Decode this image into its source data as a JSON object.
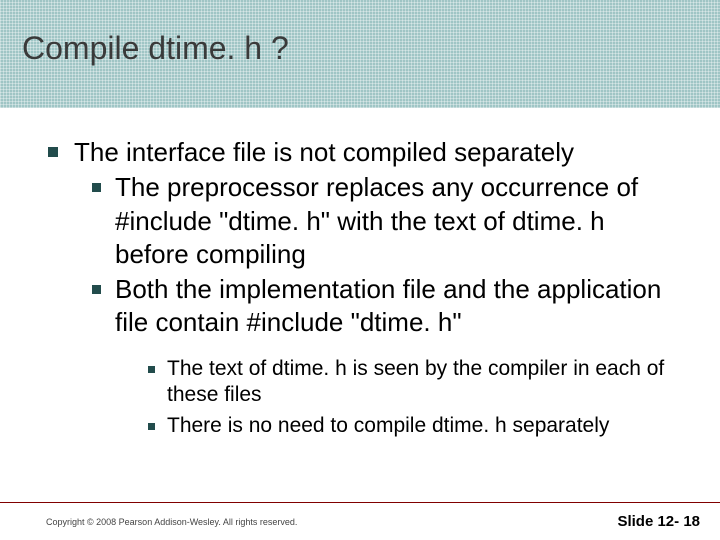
{
  "title": "Compile dtime. h ?",
  "points": {
    "p1": "The interface file is not compiled separately",
    "p1a": "The preprocessor replaces any occurrence of #include \"dtime. h\" with the text of dtime. h before compiling",
    "p1b": "Both the implementation file and the application file contain #include \"dtime. h\"",
    "p1b1": "The text of dtime. h is seen by the compiler in each of these files",
    "p1b2": "There is no need to compile dtime. h separately"
  },
  "footer": {
    "copyright": "Copyright © 2008 Pearson Addison-Wesley.  All rights reserved.",
    "slide": "Slide 12- 18"
  }
}
